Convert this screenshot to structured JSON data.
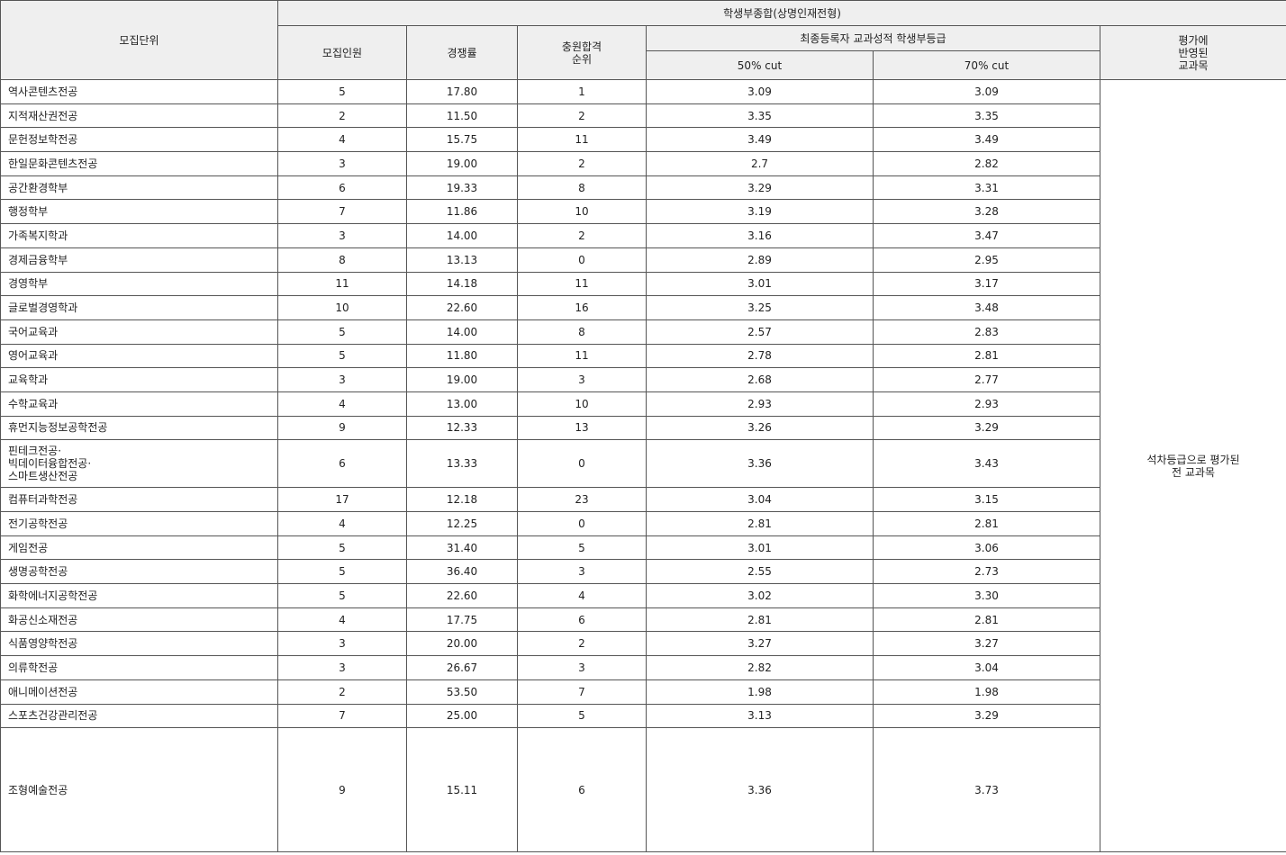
{
  "table": {
    "header": {
      "unit": "모집단위",
      "group": "학생부종합(상명인재전형)",
      "quota": "모집인원",
      "competition": "경쟁률",
      "waitlist_rank": "충원합격\n순위",
      "grade_group": "최종등록자 교과성적 학생부등급",
      "cut50": "50% cut",
      "cut70": "70% cut",
      "subjects_header": "평가에\n반영된\n교과목"
    },
    "subjects_note": "석차등급으로 평가된\n전 교과목",
    "rows": [
      {
        "name": "역사콘텐츠전공",
        "quota": "5",
        "rate": "17.80",
        "rank": "1",
        "cut50": "3.09",
        "cut70": "3.09"
      },
      {
        "name": "지적재산권전공",
        "quota": "2",
        "rate": "11.50",
        "rank": "2",
        "cut50": "3.35",
        "cut70": "3.35"
      },
      {
        "name": "문헌정보학전공",
        "quota": "4",
        "rate": "15.75",
        "rank": "11",
        "cut50": "3.49",
        "cut70": "3.49"
      },
      {
        "name": "한일문화콘텐츠전공",
        "quota": "3",
        "rate": "19.00",
        "rank": "2",
        "cut50": "2.7",
        "cut70": "2.82"
      },
      {
        "name": "공간환경학부",
        "quota": "6",
        "rate": "19.33",
        "rank": "8",
        "cut50": "3.29",
        "cut70": "3.31"
      },
      {
        "name": "행정학부",
        "quota": "7",
        "rate": "11.86",
        "rank": "10",
        "cut50": "3.19",
        "cut70": "3.28"
      },
      {
        "name": "가족복지학과",
        "quota": "3",
        "rate": "14.00",
        "rank": "2",
        "cut50": "3.16",
        "cut70": "3.47"
      },
      {
        "name": "경제금융학부",
        "quota": "8",
        "rate": "13.13",
        "rank": "0",
        "cut50": "2.89",
        "cut70": "2.95"
      },
      {
        "name": "경영학부",
        "quota": "11",
        "rate": "14.18",
        "rank": "11",
        "cut50": "3.01",
        "cut70": "3.17"
      },
      {
        "name": "글로벌경영학과",
        "quota": "10",
        "rate": "22.60",
        "rank": "16",
        "cut50": "3.25",
        "cut70": "3.48"
      },
      {
        "name": "국어교육과",
        "quota": "5",
        "rate": "14.00",
        "rank": "8",
        "cut50": "2.57",
        "cut70": "2.83"
      },
      {
        "name": "영어교육과",
        "quota": "5",
        "rate": "11.80",
        "rank": "11",
        "cut50": "2.78",
        "cut70": "2.81"
      },
      {
        "name": "교육학과",
        "quota": "3",
        "rate": "19.00",
        "rank": "3",
        "cut50": "2.68",
        "cut70": "2.77"
      },
      {
        "name": "수학교육과",
        "quota": "4",
        "rate": "13.00",
        "rank": "10",
        "cut50": "2.93",
        "cut70": "2.93"
      },
      {
        "name": "휴먼지능정보공학전공",
        "quota": "9",
        "rate": "12.33",
        "rank": "13",
        "cut50": "3.26",
        "cut70": "3.29"
      },
      {
        "name": "핀테크전공·\n빅데이터융합전공·\n스마트생산전공",
        "quota": "6",
        "rate": "13.33",
        "rank": "0",
        "cut50": "3.36",
        "cut70": "3.43"
      },
      {
        "name": "컴퓨터과학전공",
        "quota": "17",
        "rate": "12.18",
        "rank": "23",
        "cut50": "3.04",
        "cut70": "3.15"
      },
      {
        "name": "전기공학전공",
        "quota": "4",
        "rate": "12.25",
        "rank": "0",
        "cut50": "2.81",
        "cut70": "2.81"
      },
      {
        "name": "게임전공",
        "quota": "5",
        "rate": "31.40",
        "rank": "5",
        "cut50": "3.01",
        "cut70": "3.06"
      },
      {
        "name": "생명공학전공",
        "quota": "5",
        "rate": "36.40",
        "rank": "3",
        "cut50": "2.55",
        "cut70": "2.73"
      },
      {
        "name": "화학에너지공학전공",
        "quota": "5",
        "rate": "22.60",
        "rank": "4",
        "cut50": "3.02",
        "cut70": "3.30"
      },
      {
        "name": "화공신소재전공",
        "quota": "4",
        "rate": "17.75",
        "rank": "6",
        "cut50": "2.81",
        "cut70": "2.81"
      },
      {
        "name": "식품영양학전공",
        "quota": "3",
        "rate": "20.00",
        "rank": "2",
        "cut50": "3.27",
        "cut70": "3.27"
      },
      {
        "name": "의류학전공",
        "quota": "3",
        "rate": "26.67",
        "rank": "3",
        "cut50": "2.82",
        "cut70": "3.04"
      },
      {
        "name": "애니메이션전공",
        "quota": "2",
        "rate": "53.50",
        "rank": "7",
        "cut50": "1.98",
        "cut70": "1.98"
      },
      {
        "name": "스포츠건강관리전공",
        "quota": "7",
        "rate": "25.00",
        "rank": "5",
        "cut50": "3.13",
        "cut70": "3.29"
      },
      {
        "name": "조형예술전공",
        "quota": "9",
        "rate": "15.11",
        "rank": "6",
        "cut50": "3.36",
        "cut70": "3.73"
      }
    ]
  }
}
